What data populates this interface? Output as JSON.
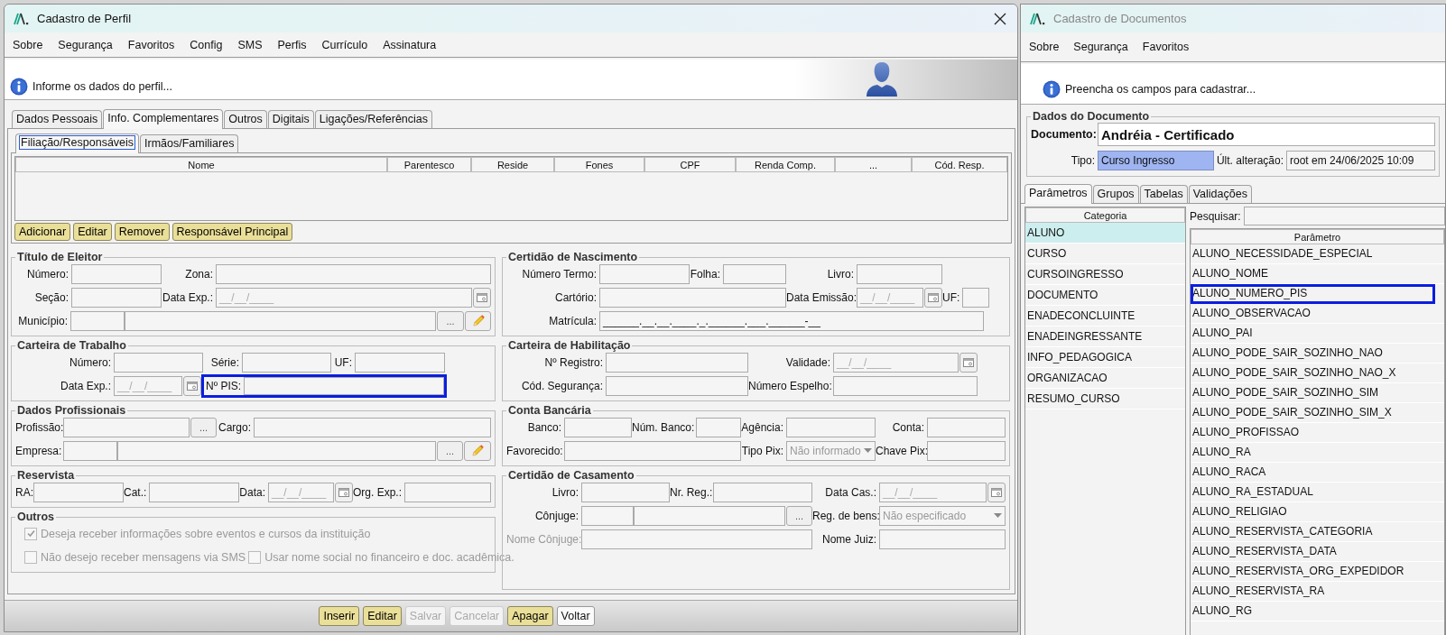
{
  "left_window": {
    "title": "Cadastro de Perfil",
    "active": true,
    "menu": [
      "Sobre",
      "Segurança",
      "Favoritos",
      "Config",
      "SMS",
      "Perfis",
      "Currículo",
      "Assinatura"
    ],
    "info_message": "Informe os dados do perfil...",
    "tabs": [
      {
        "label": "Dados Pessoais",
        "selected": false
      },
      {
        "label": "Info. Complementares",
        "selected": true
      },
      {
        "label": "Outros",
        "selected": false
      },
      {
        "label": "Digitais",
        "selected": false
      },
      {
        "label": "Ligações/Referências",
        "selected": false
      }
    ],
    "subtabs": [
      {
        "label": "Filiação/Responsáveis",
        "selected": true
      },
      {
        "label": "Irmãos/Familiares",
        "selected": false
      }
    ],
    "table": {
      "columns": [
        "Nome",
        "Parentesco",
        "Reside",
        "Fones",
        "CPF",
        "Renda Comp.",
        "...",
        "Cód. Resp."
      ]
    },
    "table_buttons": [
      "Adicionar",
      "Editar",
      "Remover",
      "Responsável Principal"
    ],
    "groups_left": [
      {
        "title": "Título de Eleitor",
        "rows": [
          {
            "items": [
              {
                "kind": "label",
                "text": "Número:"
              },
              {
                "kind": "field"
              },
              {
                "kind": "label",
                "text": "Zona:"
              },
              {
                "kind": "field"
              }
            ]
          },
          {
            "items": [
              {
                "kind": "label",
                "text": "Seção:"
              },
              {
                "kind": "field"
              },
              {
                "kind": "label",
                "text": "Data Exp.:"
              },
              {
                "kind": "date",
                "placeholder": "__/__/____"
              }
            ]
          },
          {
            "items": [
              {
                "kind": "label",
                "text": "Município:"
              },
              {
                "kind": "field"
              },
              {
                "kind": "field"
              },
              {
                "kind": "lookup",
                "text": "..."
              },
              {
                "kind": "edit"
              }
            ]
          }
        ]
      },
      {
        "title": "Carteira de Trabalho",
        "rows": [
          {
            "items": [
              {
                "kind": "label",
                "text": "Número:"
              },
              {
                "kind": "field"
              },
              {
                "kind": "label",
                "text": "Série:"
              },
              {
                "kind": "field"
              },
              {
                "kind": "label",
                "text": "UF:"
              },
              {
                "kind": "field"
              }
            ]
          },
          {
            "items": [
              {
                "kind": "label",
                "text": "Data Exp.:"
              },
              {
                "kind": "date",
                "placeholder": "__/__/____"
              },
              {
                "kind": "highlight_field",
                "label": "Nº PIS:"
              }
            ]
          }
        ]
      },
      {
        "title": "Dados Profissionais",
        "rows": [
          {
            "items": [
              {
                "kind": "label",
                "text": "Profissão:"
              },
              {
                "kind": "field"
              },
              {
                "kind": "lookup",
                "text": "..."
              },
              {
                "kind": "label",
                "text": "Cargo:"
              },
              {
                "kind": "field"
              }
            ]
          },
          {
            "items": [
              {
                "kind": "label",
                "text": "Empresa:"
              },
              {
                "kind": "field"
              },
              {
                "kind": "field"
              },
              {
                "kind": "lookup",
                "text": "..."
              },
              {
                "kind": "edit"
              }
            ]
          }
        ]
      },
      {
        "title": "Reservista",
        "rows": [
          {
            "items": [
              {
                "kind": "label",
                "text": "RA:"
              },
              {
                "kind": "field"
              },
              {
                "kind": "label",
                "text": "Cat.:"
              },
              {
                "kind": "field"
              },
              {
                "kind": "label",
                "text": "Data:"
              },
              {
                "kind": "date",
                "placeholder": "__/__/____"
              },
              {
                "kind": "label",
                "text": "Org. Exp.:"
              },
              {
                "kind": "field"
              }
            ]
          }
        ]
      },
      {
        "title": "Outros",
        "rows": [
          {
            "items": [
              {
                "kind": "checkbox",
                "label": "Deseja receber informações sobre eventos e cursos da instituição",
                "checked": true,
                "disabled": true
              }
            ]
          },
          {
            "items": [
              {
                "kind": "checkbox",
                "label": "Não desejo receber mensagens via SMS",
                "checked": false,
                "disabled": true
              },
              {
                "kind": "checkbox",
                "label": "Usar nome social no financeiro e doc. acadêmica.",
                "checked": false,
                "disabled": true
              }
            ]
          }
        ]
      }
    ],
    "groups_right": [
      {
        "title": "Certidão de Nascimento",
        "rows": [
          {
            "items": [
              {
                "kind": "label",
                "text": "Número Termo:"
              },
              {
                "kind": "field"
              },
              {
                "kind": "label",
                "text": "Folha:"
              },
              {
                "kind": "field"
              },
              {
                "kind": "label",
                "text": "Livro:"
              },
              {
                "kind": "field"
              }
            ]
          },
          {
            "items": [
              {
                "kind": "label",
                "text": "Cartório:"
              },
              {
                "kind": "field"
              },
              {
                "kind": "label",
                "text": "Data Emissão:"
              },
              {
                "kind": "date",
                "placeholder": "__/__/____"
              },
              {
                "kind": "label",
                "text": "UF:"
              },
              {
                "kind": "field"
              }
            ]
          },
          {
            "items": [
              {
                "kind": "label",
                "text": "Matrícula:"
              },
              {
                "kind": "masked",
                "value": "______.__.__.____._.______.___.______-__"
              }
            ]
          }
        ]
      },
      {
        "title": "Carteira de Habilitação",
        "rows": [
          {
            "items": [
              {
                "kind": "label",
                "text": "Nº Registro:"
              },
              {
                "kind": "field"
              },
              {
                "kind": "label",
                "text": "Validade:"
              },
              {
                "kind": "date",
                "placeholder": "__/__/____"
              }
            ]
          },
          {
            "items": [
              {
                "kind": "label",
                "text": "Cód. Segurança:"
              },
              {
                "kind": "field"
              },
              {
                "kind": "label",
                "text": "Número Espelho:"
              },
              {
                "kind": "field"
              }
            ]
          }
        ]
      },
      {
        "title": "Conta Bancária",
        "rows": [
          {
            "items": [
              {
                "kind": "label",
                "text": "Banco:"
              },
              {
                "kind": "field"
              },
              {
                "kind": "label",
                "text": "Núm. Banco:"
              },
              {
                "kind": "field"
              },
              {
                "kind": "label",
                "text": "Agência:"
              },
              {
                "kind": "field"
              },
              {
                "kind": "label",
                "text": "Conta:"
              },
              {
                "kind": "field"
              }
            ]
          },
          {
            "items": [
              {
                "kind": "label",
                "text": "Favorecido:"
              },
              {
                "kind": "field"
              },
              {
                "kind": "label",
                "text": "Tipo Pix:"
              },
              {
                "kind": "select",
                "value": "Não informado"
              },
              {
                "kind": "label",
                "text": "Chave Pix:"
              },
              {
                "kind": "field"
              }
            ]
          }
        ]
      },
      {
        "title": "Certidão de Casamento",
        "rows": [
          {
            "items": [
              {
                "kind": "label",
                "text": "Livro:"
              },
              {
                "kind": "field"
              },
              {
                "kind": "label",
                "text": "Nr. Reg.:"
              },
              {
                "kind": "field"
              },
              {
                "kind": "label",
                "text": "Data Cas.:"
              },
              {
                "kind": "date",
                "placeholder": "__/__/____"
              }
            ]
          },
          {
            "items": [
              {
                "kind": "label",
                "text": "Cônjuge:"
              },
              {
                "kind": "field"
              },
              {
                "kind": "field"
              },
              {
                "kind": "lookup",
                "text": "..."
              },
              {
                "kind": "label",
                "text": "Reg. de bens:"
              },
              {
                "kind": "select",
                "value": "Não especificado"
              }
            ]
          },
          {
            "items": [
              {
                "kind": "label",
                "text": "Nome Cônjuge:",
                "disabled": true
              },
              {
                "kind": "field"
              },
              {
                "kind": "label",
                "text": "Nome Juiz:"
              },
              {
                "kind": "field"
              }
            ]
          }
        ]
      }
    ],
    "footer_buttons": [
      {
        "label": "Inserir",
        "kind": "accent",
        "disabled": false
      },
      {
        "label": "Editar",
        "kind": "accent",
        "disabled": false
      },
      {
        "label": "Salvar",
        "kind": "plain",
        "disabled": true
      },
      {
        "label": "Cancelar",
        "kind": "plain",
        "disabled": true
      },
      {
        "label": "Apagar",
        "kind": "accent",
        "disabled": false
      },
      {
        "label": "Voltar",
        "kind": "plain",
        "disabled": false
      }
    ]
  },
  "right_window": {
    "title": "Cadastro de Documentos",
    "active": false,
    "menu": [
      "Sobre",
      "Segurança",
      "Favoritos"
    ],
    "info_message": "Preencha os campos para cadastrar...",
    "document_group": {
      "title": "Dados do Documento",
      "document_label": "Documento:",
      "document_value": "Andréia - Certificado",
      "type_label": "Tipo:",
      "type_value": "Curso Ingresso",
      "changed_label": "Últ. alteração:",
      "changed_value": "root em 24/06/2025 10:09"
    },
    "tabs": [
      {
        "label": "Parâmetros",
        "selected": true
      },
      {
        "label": "Grupos",
        "selected": false
      },
      {
        "label": "Tabelas",
        "selected": false
      },
      {
        "label": "Validações",
        "selected": false
      }
    ],
    "category_list": {
      "header": "Categoria",
      "items": [
        {
          "label": "ALUNO",
          "selected": true
        },
        {
          "label": "CURSO",
          "selected": false
        },
        {
          "label": "CURSOINGRESSO",
          "selected": false
        },
        {
          "label": "DOCUMENTO",
          "selected": false
        },
        {
          "label": "ENADECONCLUINTE",
          "selected": false
        },
        {
          "label": "ENADEINGRESSANTE",
          "selected": false
        },
        {
          "label": "INFO_PEDAGOGICA",
          "selected": false
        },
        {
          "label": "ORGANIZACAO",
          "selected": false
        },
        {
          "label": "RESUMO_CURSO",
          "selected": false
        }
      ]
    },
    "search_label": "Pesquisar:",
    "parameter_table": {
      "header": "Parâmetro",
      "rows": [
        {
          "label": "ALUNO_NECESSIDADE_ESPECIAL",
          "highlighted": false
        },
        {
          "label": "ALUNO_NOME",
          "highlighted": false
        },
        {
          "label": "ALUNO_NUMERO_PIS",
          "highlighted": true
        },
        {
          "label": "ALUNO_OBSERVACAO",
          "highlighted": false
        },
        {
          "label": "ALUNO_PAI",
          "highlighted": false
        },
        {
          "label": "ALUNO_PODE_SAIR_SOZINHO_NAO",
          "highlighted": false
        },
        {
          "label": "ALUNO_PODE_SAIR_SOZINHO_NAO_X",
          "highlighted": false
        },
        {
          "label": "ALUNO_PODE_SAIR_SOZINHO_SIM",
          "highlighted": false
        },
        {
          "label": "ALUNO_PODE_SAIR_SOZINHO_SIM_X",
          "highlighted": false
        },
        {
          "label": "ALUNO_PROFISSAO",
          "highlighted": false
        },
        {
          "label": "ALUNO_RA",
          "highlighted": false
        },
        {
          "label": "ALUNO_RACA",
          "highlighted": false
        },
        {
          "label": "ALUNO_RA_ESTADUAL",
          "highlighted": false
        },
        {
          "label": "ALUNO_RELIGIAO",
          "highlighted": false
        },
        {
          "label": "ALUNO_RESERVISTA_CATEGORIA",
          "highlighted": false
        },
        {
          "label": "ALUNO_RESERVISTA_DATA",
          "highlighted": false
        },
        {
          "label": "ALUNO_RESERVISTA_ORG_EXPEDIDOR",
          "highlighted": false
        },
        {
          "label": "ALUNO_RESERVISTA_RA",
          "highlighted": false
        },
        {
          "label": "ALUNO_RG",
          "highlighted": false
        }
      ]
    }
  }
}
